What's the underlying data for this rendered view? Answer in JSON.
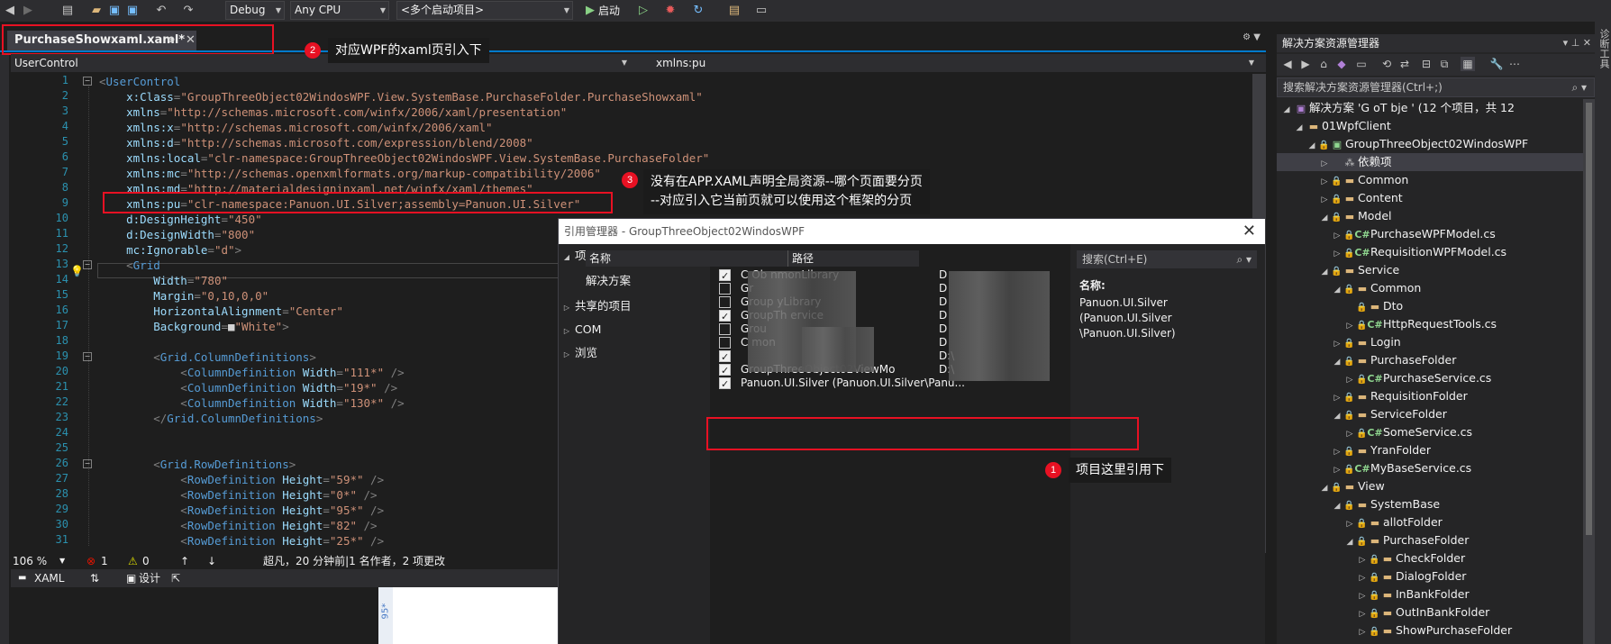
{
  "toolbar": {
    "config": "Debug",
    "platform": "Any CPU",
    "startup": "<多个启动项目>",
    "start_label": "启动"
  },
  "doc_tab": {
    "title": "PurchaseShowxaml.xaml*",
    "pin": "⊕",
    "close": "✕"
  },
  "nav": {
    "left": "UserControl",
    "right": "xmlns:pu"
  },
  "code": [
    {
      "n": "1",
      "parts": [
        [
          "c-punc",
          "<"
        ],
        [
          "c-tag",
          "UserControl"
        ]
      ]
    },
    {
      "n": "2",
      "parts": [
        [
          "c-attr",
          "    x:Class"
        ],
        [
          "c-punc",
          "="
        ],
        [
          "c-val",
          "\"GroupThreeObject02WindosWPF.View.SystemBase.PurchaseFolder.PurchaseShowxaml\""
        ]
      ]
    },
    {
      "n": "3",
      "parts": [
        [
          "c-attr",
          "    xmlns"
        ],
        [
          "c-punc",
          "="
        ],
        [
          "c-val",
          "\"http://schemas.microsoft.com/winfx/2006/xaml/presentation\""
        ]
      ]
    },
    {
      "n": "4",
      "parts": [
        [
          "c-attr",
          "    xmlns:x"
        ],
        [
          "c-punc",
          "="
        ],
        [
          "c-val",
          "\"http://schemas.microsoft.com/winfx/2006/xaml\""
        ]
      ]
    },
    {
      "n": "5",
      "parts": [
        [
          "c-attr",
          "    xmlns:d"
        ],
        [
          "c-punc",
          "="
        ],
        [
          "c-val",
          "\"http://schemas.microsoft.com/expression/blend/2008\""
        ]
      ]
    },
    {
      "n": "6",
      "parts": [
        [
          "c-attr",
          "    xmlns:local"
        ],
        [
          "c-punc",
          "="
        ],
        [
          "c-val",
          "\"clr-namespace:GroupThreeObject02WindosWPF.View.SystemBase.PurchaseFolder\""
        ]
      ]
    },
    {
      "n": "7",
      "parts": [
        [
          "c-attr",
          "    xmlns:mc"
        ],
        [
          "c-punc",
          "="
        ],
        [
          "c-val",
          "\"http://schemas.openxmlformats.org/markup-compatibility/2006\""
        ]
      ]
    },
    {
      "n": "8",
      "parts": [
        [
          "c-attr",
          "    xmlns:md"
        ],
        [
          "c-punc",
          "="
        ],
        [
          "c-val",
          "\"http://materialdesigninxaml.net/winfx/xaml/themes\""
        ]
      ]
    },
    {
      "n": "9",
      "parts": [
        [
          "c-attr",
          "    xmlns:pu"
        ],
        [
          "c-punc",
          "="
        ],
        [
          "c-val",
          "\"clr-namespace:Panuon.UI.Silver;assembly=Panuon.UI.Silver\""
        ]
      ]
    },
    {
      "n": "10",
      "parts": [
        [
          "c-attr",
          "    d:DesignHeight"
        ],
        [
          "c-punc",
          "="
        ],
        [
          "c-val",
          "\"450\""
        ]
      ]
    },
    {
      "n": "11",
      "parts": [
        [
          "c-attr",
          "    d:DesignWidth"
        ],
        [
          "c-punc",
          "="
        ],
        [
          "c-val",
          "\"800\""
        ]
      ]
    },
    {
      "n": "12",
      "parts": [
        [
          "c-attr",
          "    mc:Ignorable"
        ],
        [
          "c-punc",
          "="
        ],
        [
          "c-val",
          "\"d\""
        ],
        [
          "c-punc",
          ">"
        ]
      ]
    },
    {
      "n": "13",
      "parts": [
        [
          "c-punc",
          "    <"
        ],
        [
          "c-tag",
          "Grid"
        ]
      ]
    },
    {
      "n": "14",
      "parts": [
        [
          "c-attr",
          "        Width"
        ],
        [
          "c-punc",
          "="
        ],
        [
          "c-val",
          "\"780\""
        ]
      ]
    },
    {
      "n": "15",
      "parts": [
        [
          "c-attr",
          "        Margin"
        ],
        [
          "c-punc",
          "="
        ],
        [
          "c-val",
          "\"0,10,0,0\""
        ]
      ]
    },
    {
      "n": "16",
      "parts": [
        [
          "c-attr",
          "        HorizontalAlignment"
        ],
        [
          "c-punc",
          "="
        ],
        [
          "c-val",
          "\"Center\""
        ]
      ]
    },
    {
      "n": "17",
      "parts": [
        [
          "c-attr",
          "        Background"
        ],
        [
          "c-punc",
          "="
        ],
        [
          "c-plain",
          "■"
        ],
        [
          "c-val",
          "\"White\""
        ],
        [
          "c-punc",
          ">"
        ]
      ]
    },
    {
      "n": "18",
      "parts": [
        [
          "c-plain",
          ""
        ]
      ]
    },
    {
      "n": "19",
      "parts": [
        [
          "c-punc",
          "        <"
        ],
        [
          "c-tag",
          "Grid.ColumnDefinitions"
        ],
        [
          "c-punc",
          ">"
        ]
      ]
    },
    {
      "n": "20",
      "parts": [
        [
          "c-punc",
          "            <"
        ],
        [
          "c-tag",
          "ColumnDefinition "
        ],
        [
          "c-attr",
          "Width"
        ],
        [
          "c-punc",
          "="
        ],
        [
          "c-val",
          "\"111*\""
        ],
        [
          "c-punc",
          " />"
        ]
      ]
    },
    {
      "n": "21",
      "parts": [
        [
          "c-punc",
          "            <"
        ],
        [
          "c-tag",
          "ColumnDefinition "
        ],
        [
          "c-attr",
          "Width"
        ],
        [
          "c-punc",
          "="
        ],
        [
          "c-val",
          "\"19*\""
        ],
        [
          "c-punc",
          " />"
        ]
      ]
    },
    {
      "n": "22",
      "parts": [
        [
          "c-punc",
          "            <"
        ],
        [
          "c-tag",
          "ColumnDefinition "
        ],
        [
          "c-attr",
          "Width"
        ],
        [
          "c-punc",
          "="
        ],
        [
          "c-val",
          "\"130*\""
        ],
        [
          "c-punc",
          " />"
        ]
      ]
    },
    {
      "n": "23",
      "parts": [
        [
          "c-punc",
          "        </"
        ],
        [
          "c-tag",
          "Grid.ColumnDefinitions"
        ],
        [
          "c-punc",
          ">"
        ]
      ]
    },
    {
      "n": "24",
      "parts": [
        [
          "c-plain",
          ""
        ]
      ]
    },
    {
      "n": "25",
      "parts": [
        [
          "c-plain",
          ""
        ]
      ]
    },
    {
      "n": "26",
      "parts": [
        [
          "c-punc",
          "        <"
        ],
        [
          "c-tag",
          "Grid.RowDefinitions"
        ],
        [
          "c-punc",
          ">"
        ]
      ]
    },
    {
      "n": "27",
      "parts": [
        [
          "c-punc",
          "            <"
        ],
        [
          "c-tag",
          "RowDefinition "
        ],
        [
          "c-attr",
          "Height"
        ],
        [
          "c-punc",
          "="
        ],
        [
          "c-val",
          "\"59*\""
        ],
        [
          "c-punc",
          " />"
        ]
      ]
    },
    {
      "n": "28",
      "parts": [
        [
          "c-punc",
          "            <"
        ],
        [
          "c-tag",
          "RowDefinition "
        ],
        [
          "c-attr",
          "Height"
        ],
        [
          "c-punc",
          "="
        ],
        [
          "c-val",
          "\"0*\""
        ],
        [
          "c-punc",
          " />"
        ]
      ]
    },
    {
      "n": "29",
      "parts": [
        [
          "c-punc",
          "            <"
        ],
        [
          "c-tag",
          "RowDefinition "
        ],
        [
          "c-attr",
          "Height"
        ],
        [
          "c-punc",
          "="
        ],
        [
          "c-val",
          "\"95*\""
        ],
        [
          "c-punc",
          " />"
        ]
      ]
    },
    {
      "n": "30",
      "parts": [
        [
          "c-punc",
          "            <"
        ],
        [
          "c-tag",
          "RowDefinition "
        ],
        [
          "c-attr",
          "Height"
        ],
        [
          "c-punc",
          "="
        ],
        [
          "c-val",
          "\"82\""
        ],
        [
          "c-punc",
          " />"
        ]
      ]
    },
    {
      "n": "31",
      "parts": [
        [
          "c-punc",
          "            <"
        ],
        [
          "c-tag",
          "RowDefinition "
        ],
        [
          "c-attr",
          "Height"
        ],
        [
          "c-punc",
          "="
        ],
        [
          "c-val",
          "\"25*\""
        ],
        [
          "c-punc",
          " />"
        ]
      ]
    }
  ],
  "editor_status": {
    "zoom": "106 %",
    "errors": "1",
    "warnings": "0",
    "git_info": "超凡，20 分钟前|1 名作者，2 项更改"
  },
  "bottom_tabs": {
    "xaml": "XAML",
    "design": "设计"
  },
  "design_ruler": "95*",
  "solution": {
    "title": "解决方案资源管理器",
    "search_placeholder": "搜索解决方案资源管理器(Ctrl+;)",
    "root": "解决方案 'G      oT       bje      ' (12 个项目，共 12",
    "nodes": [
      {
        "label": "01WpfClient",
        "kind": "folder-root"
      },
      {
        "label": "GroupThreeObject02WindosWPF",
        "kind": "project"
      },
      {
        "label": "依赖项",
        "kind": "deps"
      },
      {
        "label": "Common",
        "kind": "folder"
      },
      {
        "label": "Content",
        "kind": "folder"
      },
      {
        "label": "Model",
        "kind": "folder"
      },
      {
        "label": "PurchaseWPFModel.cs",
        "kind": "cs"
      },
      {
        "label": "RequisitionWPFModel.cs",
        "kind": "cs"
      },
      {
        "label": "Service",
        "kind": "folder"
      },
      {
        "label": "Common",
        "kind": "folder"
      },
      {
        "label": "Dto",
        "kind": "folder"
      },
      {
        "label": "HttpRequestTools.cs",
        "kind": "cs"
      },
      {
        "label": "Login",
        "kind": "folder"
      },
      {
        "label": "PurchaseFolder",
        "kind": "folder"
      },
      {
        "label": "PurchaseService.cs",
        "kind": "cs"
      },
      {
        "label": "RequisitionFolder",
        "kind": "folder"
      },
      {
        "label": "ServiceFolder",
        "kind": "folder"
      },
      {
        "label": "SomeService.cs",
        "kind": "cs"
      },
      {
        "label": "YranFolder",
        "kind": "folder"
      },
      {
        "label": "MyBaseService.cs",
        "kind": "cs"
      },
      {
        "label": "View",
        "kind": "folder"
      },
      {
        "label": "SystemBase",
        "kind": "folder"
      },
      {
        "label": "allotFolder",
        "kind": "folder"
      },
      {
        "label": "PurchaseFolder",
        "kind": "folder"
      },
      {
        "label": "CheckFolder",
        "kind": "folder"
      },
      {
        "label": "DialogFolder",
        "kind": "folder"
      },
      {
        "label": "InBankFolder",
        "kind": "folder"
      },
      {
        "label": "OutInBankFolder",
        "kind": "folder"
      },
      {
        "label": "ShowPurchaseFolder",
        "kind": "folder"
      }
    ]
  },
  "right_strip": "诊断工具",
  "dialog": {
    "title": "引用管理器 - GroupThreeObject02WindosWPF",
    "close": "✕",
    "nav": [
      {
        "label": "项目",
        "expanded": true
      },
      {
        "label": "解决方案",
        "child": true
      },
      {
        "label": "共享的项目",
        "expanded": false
      },
      {
        "label": "COM",
        "expanded": false
      },
      {
        "label": "浏览",
        "expanded": false
      }
    ],
    "col_name": "名称",
    "col_path": "路径",
    "search_placeholder": "搜索(Ctrl+E)",
    "refs": [
      {
        "name": "C              Ob        nmonLibrary",
        "path": "D",
        "checked": true
      },
      {
        "name": "Gr",
        "path": "D",
        "checked": false
      },
      {
        "name": "Group                              yLibrary",
        "path": "D",
        "checked": false
      },
      {
        "name": "GroupTh                         ervice",
        "path": "D",
        "checked": true
      },
      {
        "name": "Grou",
        "path": "D",
        "checked": false
      },
      {
        "name": "C                                   mon",
        "path": "D",
        "checked": false
      },
      {
        "name": "",
        "path": "D:\\",
        "checked": true
      },
      {
        "name": "GroupThreeObject02ViewMo",
        "path": "D:\\",
        "checked": true
      },
      {
        "name": "Panuon.UI.Silver (Panuon.UI.Silver\\Panu...",
        "path": "",
        "checked": true
      }
    ],
    "detail_label": "名称:",
    "detail_lines": [
      "Panuon.UI.Silver",
      "(Panuon.UI.Silver",
      "\\Panuon.UI.Silver)"
    ]
  },
  "annotations": {
    "n1": "1",
    "t1": "项目这里引用下",
    "n2": "2",
    "t2": "对应WPF的xaml页引入下",
    "n3": "3",
    "t3_line1": "没有在APP.XAML声明全局资源--哪个页面要分页",
    "t3_line2": "--对应引入它当前页就可以使用这个框架的分页"
  },
  "colors": {
    "accent": "#007acc",
    "highlight_red": "#e81123"
  }
}
